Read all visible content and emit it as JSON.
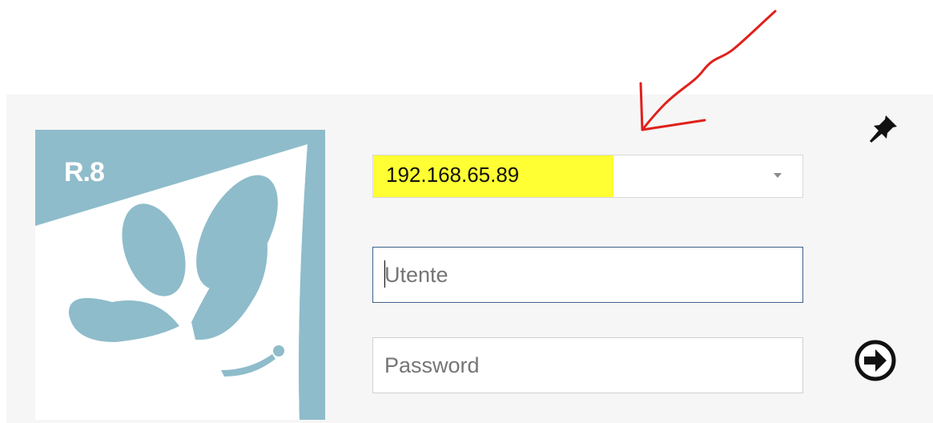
{
  "logo": {
    "text": "R.8",
    "icon": "butterfly-logo-icon"
  },
  "server": {
    "value": "192.168.65.89",
    "dropdown_icon": "chevron-down-icon"
  },
  "user": {
    "placeholder": "Utente",
    "value": ""
  },
  "password": {
    "placeholder": "Password",
    "value": ""
  },
  "actions": {
    "login_icon": "arrow-right-circle-icon",
    "pin_icon": "pin-icon"
  },
  "annotation": {
    "icon": "red-arrow-annotation",
    "color": "#e0201b"
  },
  "colors": {
    "logo_bg": "#8ebccb",
    "logo_fg": "#ffffff",
    "highlight": "#ffff33",
    "focus_border": "#3b5f8a"
  }
}
